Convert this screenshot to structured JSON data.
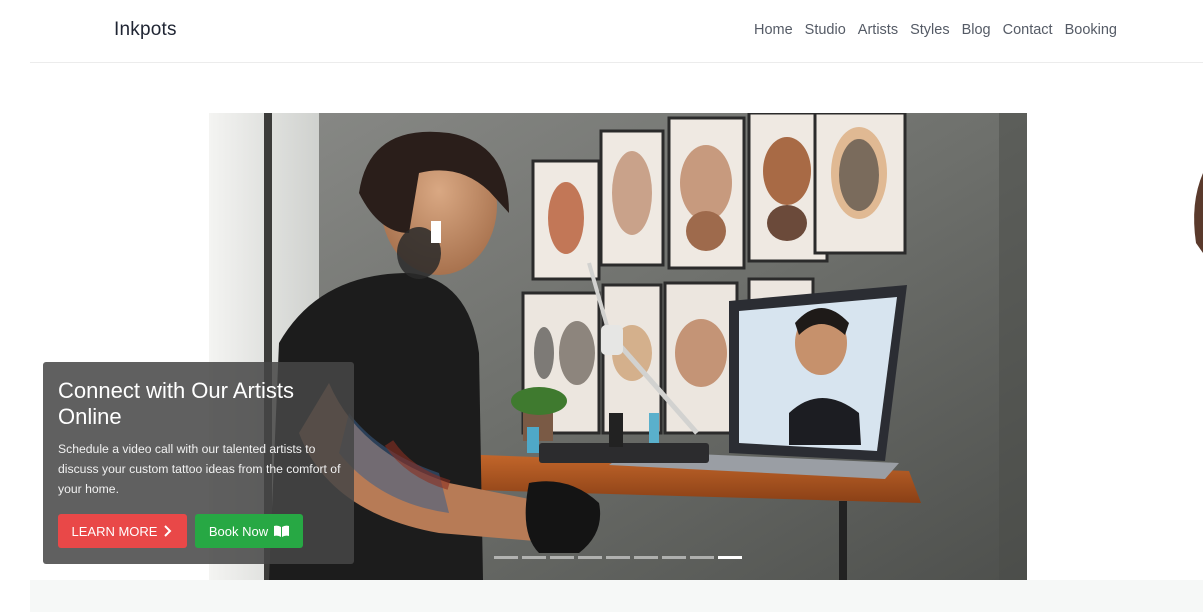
{
  "brand": {
    "name": "Inkpots"
  },
  "nav": {
    "links": [
      "Home",
      "Studio",
      "Artists",
      "Styles",
      "Blog",
      "Contact",
      "Booking"
    ]
  },
  "hero": {
    "title": "Connect with Our Artists Online",
    "description": "Schedule a video call with our talented artists to discuss your custom tattoo ideas from the comfort of your home.",
    "learn_more_label": "LEARN MORE",
    "book_now_label": "Book Now",
    "learn_more_icon": "chevron-right-icon",
    "book_now_icon": "book-open-icon",
    "slide_count": 9,
    "active_slide": 9,
    "image": "tattoo artist on video call with client at desk"
  },
  "colors": {
    "learn_more": "#e94848",
    "book_now": "#27a844",
    "caption_bg": "#464646",
    "brand_text": "#1f2533",
    "nav_text": "#555b66"
  }
}
